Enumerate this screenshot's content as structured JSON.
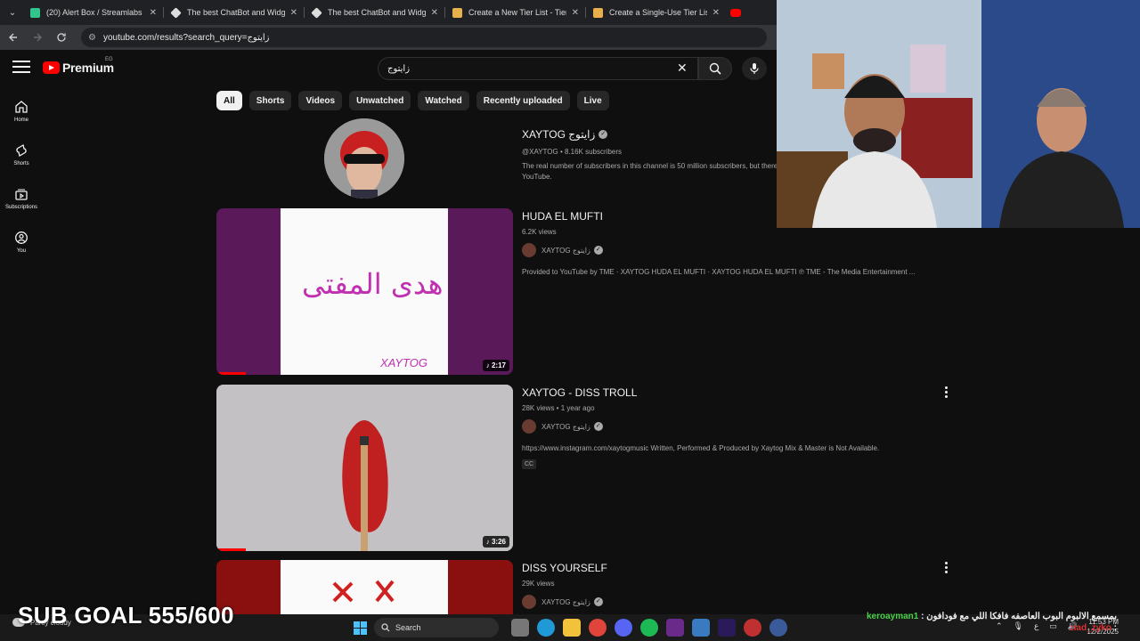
{
  "browser": {
    "tabs": [
      {
        "title": "(20) Alert Box / Streamlabs",
        "color": "#31c48d"
      },
      {
        "title": "The best ChatBot and Widgets",
        "color": "#dddddd"
      },
      {
        "title": "The best ChatBot and Widgets",
        "color": "#dddddd"
      },
      {
        "title": "Create a New Tier List - TierMa",
        "color": "#e8b04a"
      },
      {
        "title": "Create a Single-Use Tier List (F",
        "color": "#e8b04a"
      }
    ],
    "url": "youtube.com/results?search_query=زايتوج"
  },
  "header": {
    "logo_text": "Premium",
    "region": "EG",
    "search_value": "زايتوج"
  },
  "rail": [
    {
      "label": "Home",
      "icon": "home-icon"
    },
    {
      "label": "Shorts",
      "icon": "shorts-icon"
    },
    {
      "label": "Subscriptions",
      "icon": "subscriptions-icon"
    },
    {
      "label": "You",
      "icon": "you-icon"
    }
  ],
  "chips": [
    "All",
    "Shorts",
    "Videos",
    "Unwatched",
    "Watched",
    "Recently uploaded",
    "Live"
  ],
  "channel": {
    "name": "XAYTOG زايتوج",
    "meta": "@XAYTOG • 8.16K subscribers",
    "desc": "The real number of subscribers in this channel is 50 million subscribers, but there",
    "desc2": "YouTube."
  },
  "videos": [
    {
      "title": "HUDA EL MUFTI",
      "meta": "6.2K views",
      "channel": "XAYTOG زايتوج",
      "desc": "Provided to YouTube by TME · XAYTOG HUDA EL MUFTI · XAYTOG HUDA EL MUFTI ℗ TME - The Media Entertainment ...",
      "duration": "2:17",
      "thumb_art": "هدى المفتى",
      "thumb_caption": "XAYTOG",
      "watched_fraction": 0.1
    },
    {
      "title": "XAYTOG - DISS TROLL",
      "meta": "28K views • 1 year ago",
      "channel": "XAYTOG زايتوج",
      "desc": "https://www.instagram.com/xaytogmusic Written, Performed & Produced by Xaytog Mix & Master is Not Available.",
      "cc": "CC",
      "duration": "3:26",
      "watched_fraction": 0.1
    },
    {
      "title": "DISS YOURSELF",
      "meta": "29K views",
      "channel": "XAYTOG زايتوج"
    }
  ],
  "overlay": {
    "sub_goal": "SUB GOAL 555/600",
    "chat": [
      {
        "user": "keroayman1",
        "text": "بمسمع الالبوم البوب العاصفه فافكا اللي مع فودافون"
      },
      {
        "user": "ziad_zyko",
        "text": ""
      }
    ]
  },
  "taskbar": {
    "weather": "Partly cloudy",
    "search": "Search",
    "lang": "ع",
    "time": "11:53 PM",
    "date": "12/2/2025"
  }
}
